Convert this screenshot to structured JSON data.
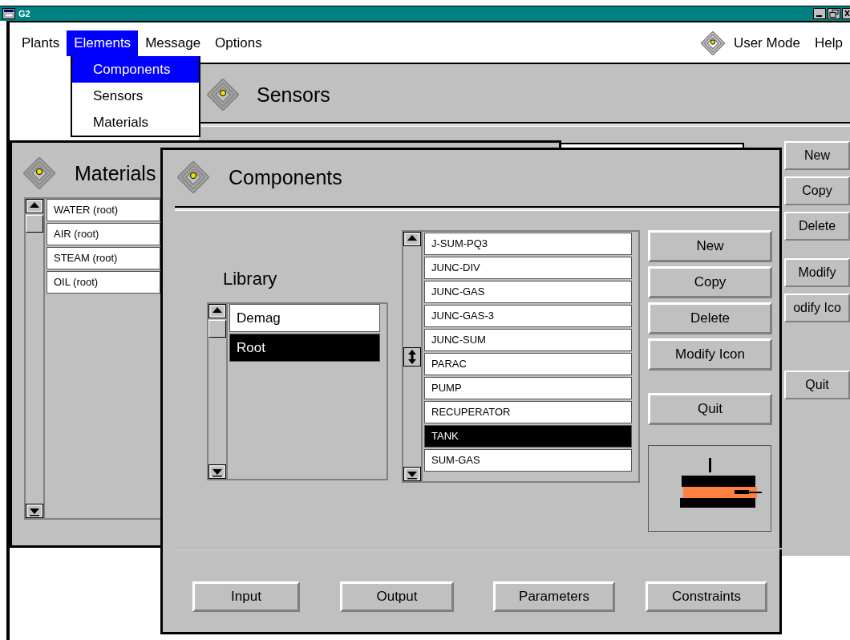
{
  "window": {
    "title": "G2"
  },
  "menu": {
    "items": [
      {
        "label": "Plants",
        "selected": false
      },
      {
        "label": "Elements",
        "selected": true
      },
      {
        "label": "Message",
        "selected": false
      },
      {
        "label": "Options",
        "selected": false
      }
    ],
    "right_items": [
      {
        "label": "User Mode"
      },
      {
        "label": "Help"
      }
    ]
  },
  "dropdown": [
    {
      "label": "Components",
      "selected": true
    },
    {
      "label": "Sensors",
      "selected": false
    },
    {
      "label": "Materials",
      "selected": false
    }
  ],
  "sensors_window": {
    "title": "Sensors",
    "buttons": [
      "New",
      "Copy",
      "Delete",
      "Modify",
      "odify Ico",
      "Quit"
    ]
  },
  "materials_window": {
    "title": "Materials",
    "items": [
      {
        "label": "WATER (root)",
        "selected": false
      },
      {
        "label": "AIR (root)",
        "selected": false
      },
      {
        "label": "STEAM (root)",
        "selected": false
      },
      {
        "label": "OIL (root)",
        "selected": false
      }
    ]
  },
  "components_window": {
    "title": "Components",
    "library_label": "Library",
    "library_items": [
      {
        "label": "Demag",
        "selected": false
      },
      {
        "label": "Root",
        "selected": true
      }
    ],
    "component_items": [
      {
        "label": "J-SUM-PQ3",
        "selected": false
      },
      {
        "label": "JUNC-DIV",
        "selected": false
      },
      {
        "label": "JUNC-GAS",
        "selected": false
      },
      {
        "label": "JUNC-GAS-3",
        "selected": false
      },
      {
        "label": "JUNC-SUM",
        "selected": false
      },
      {
        "label": "PARAC",
        "selected": false
      },
      {
        "label": "PUMP",
        "selected": false
      },
      {
        "label": "RECUPERATOR",
        "selected": false
      },
      {
        "label": "TANK",
        "selected": true
      },
      {
        "label": "SUM-GAS",
        "selected": false
      }
    ],
    "buttons": [
      "New",
      "Copy",
      "Delete",
      "Modify Icon",
      "Quit"
    ],
    "bottom_buttons": [
      "Input",
      "Output",
      "Parameters",
      "Constraints"
    ]
  }
}
